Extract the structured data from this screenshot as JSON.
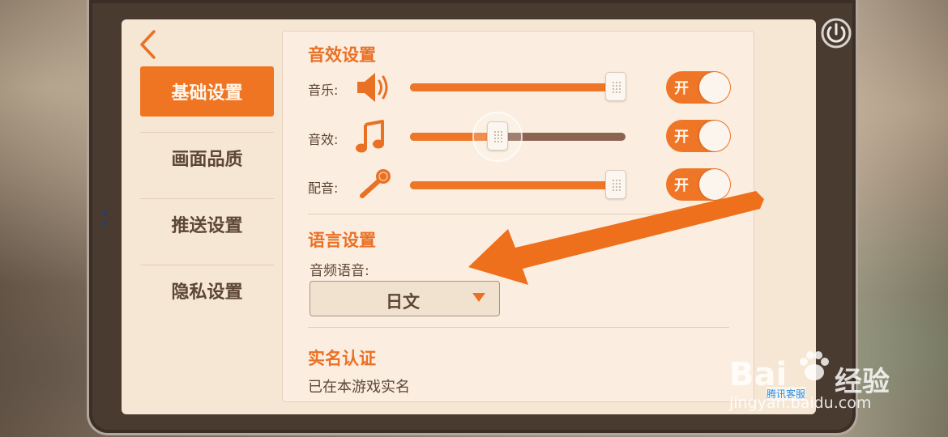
{
  "sidebar": {
    "items": [
      {
        "label": "基础设置",
        "active": true
      },
      {
        "label": "画面品质",
        "active": false
      },
      {
        "label": "推送设置",
        "active": false
      },
      {
        "label": "隐私设置",
        "active": false
      }
    ]
  },
  "audio": {
    "title": "音效设置",
    "rows": [
      {
        "label": "音乐:",
        "icon": "speaker-icon",
        "level": 1.0,
        "toggle": "开"
      },
      {
        "label": "音效:",
        "icon": "music-note-icon",
        "level": 0.41,
        "toggle": "开"
      },
      {
        "label": "配音:",
        "icon": "microphone-icon",
        "level": 1.0,
        "toggle": "开"
      }
    ]
  },
  "language": {
    "title": "语言设置",
    "voice_label": "音频语音:",
    "voice_value": "日文"
  },
  "realname": {
    "title": "实名认证",
    "status": "已在本游戏实名"
  },
  "watermark": {
    "brand": "Bai",
    "brand_suffix": "经验",
    "url": "jingyan.baidu.com",
    "sub": "腾讯客服"
  },
  "colors": {
    "accent": "#ee7626",
    "text": "#5d4636",
    "panel": "#fbeee0",
    "frame": "#4a3b31"
  }
}
